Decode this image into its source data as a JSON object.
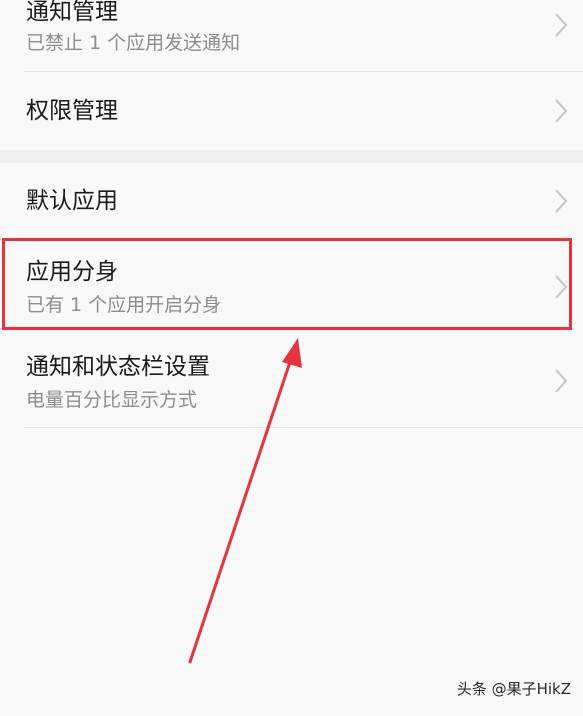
{
  "settings": {
    "items": [
      {
        "title": "通知管理",
        "subtitle": "已禁止 1 个应用发送通知"
      },
      {
        "title": "权限管理",
        "subtitle": ""
      },
      {
        "title": "默认应用",
        "subtitle": ""
      },
      {
        "title": "应用分身",
        "subtitle": "已有 1 个应用开启分身"
      },
      {
        "title": "通知和状态栏设置",
        "subtitle": "电量百分比显示方式"
      }
    ]
  },
  "annotation": {
    "highlight_color": "#e5343e",
    "arrow_color": "#e5343e"
  },
  "watermark": {
    "text": "头条 @果子HikZ"
  },
  "icons": {
    "chevron": "chevron-right-icon"
  }
}
